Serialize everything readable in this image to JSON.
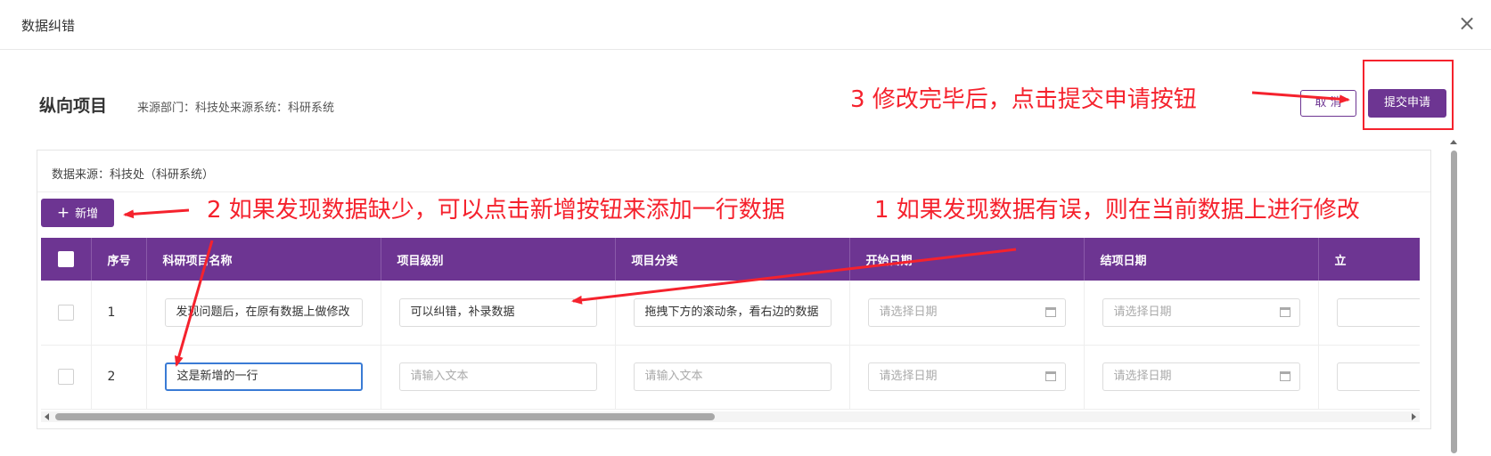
{
  "dialog": {
    "title": "数据纠错",
    "close_icon": "close-icon"
  },
  "section": {
    "title": "纵向项目",
    "meta": "来源部门：科技处来源系统：科研系统"
  },
  "actions": {
    "cancel": "取 消",
    "submit": "提交申请"
  },
  "panel": {
    "source": "数据来源：科技处（科研系统）",
    "add_button": "新增",
    "add_icon": "plus-icon"
  },
  "table": {
    "headers": [
      "序号",
      "科研项目名称",
      "项目级别",
      "项目分类",
      "开始日期",
      "结项日期",
      "立"
    ],
    "rows": [
      {
        "no": "1",
        "name": "发现问题后，在原有数据上做修改",
        "level": "可以纠错，补录数据",
        "category": "拖拽下方的滚动条，看右边的数据",
        "start": "请选择日期",
        "end": "请选择日期"
      },
      {
        "no": "2",
        "name": "这是新增的一行",
        "level": "请输入文本",
        "category": "请输入文本",
        "start": "请选择日期",
        "end": "请选择日期"
      }
    ]
  },
  "annotations": {
    "step3": "3 修改完毕后，点击提交申请按钮",
    "step2": "2 如果发现数据缺少，可以点击新增按钮来添加一行数据",
    "step1": "1 如果发现数据有误，则在当前数据上进行修改"
  },
  "colors": {
    "primary": "#6d3592",
    "annotation": "#f5222d",
    "focus": "#3a7bd5"
  }
}
